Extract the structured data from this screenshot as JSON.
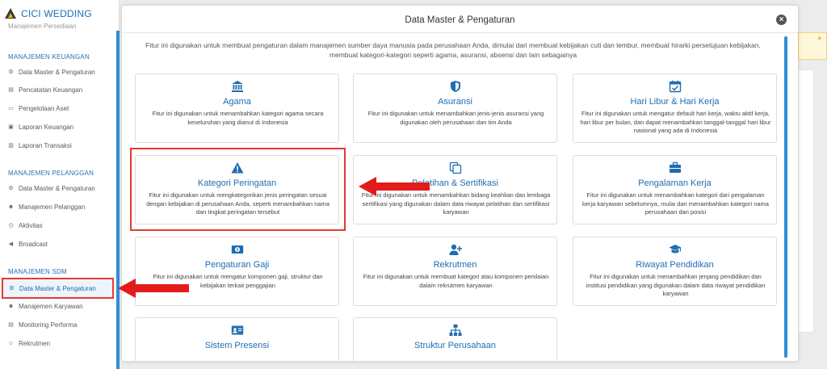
{
  "app": {
    "name": "CICI WEDDING"
  },
  "sidebar": {
    "cut_item": "Manajemen Persediaan",
    "sections": [
      {
        "title": "MANAJEMEN KEUANGAN",
        "items": [
          "Data Master & Pengaturan",
          "Pencatatan Keuangan",
          "Pengelolaan Aset",
          "Laporan Keuangan",
          "Laporan Transaksi"
        ]
      },
      {
        "title": "MANAJEMEN PELANGGAN",
        "items": [
          "Data Master & Pengaturan",
          "Manajemen Pelanggan",
          "Aktivitas",
          "Broadcast"
        ]
      },
      {
        "title": "MANAJEMEN SDM",
        "items": [
          "Data Master & Pengaturan",
          "Manajemen Karyawan",
          "Monitoring Performa",
          "Rekrutmen"
        ]
      }
    ],
    "active_item": "Data Master & Pengaturan"
  },
  "background": {
    "close_glyph": "×"
  },
  "modal": {
    "title": "Data Master & Pengaturan",
    "close_glyph": "×",
    "intro": "Fitur ini digunakan untuk membuat pengaturan dalam manajemen sumber daya manusia pada perusahaan Anda, dimulai dari membuat kebijakan cuti dan lembur, membuat hirarki persetujuan kebijakan, membuat kategori-kategori seperti agama, asuransi, absensi dan lain sebagainya",
    "cards": [
      {
        "title": "Agama",
        "icon": "bank-icon",
        "desc": "Fitur ini digunakan untuk menambahkan kategori agama secara keseluruhan yang dianut di Indonesia"
      },
      {
        "title": "Asuransi",
        "icon": "shield-icon",
        "desc": "Fitur ini digunakan untuk menambahkan jenis-jenis asuransi yang digunakan oleh perusahaan dan tim Anda"
      },
      {
        "title": "Hari Libur & Hari Kerja",
        "icon": "calendar-check-icon",
        "desc": "Fitur ini digunakan untuk mengatur default hari kerja, waktu aktif kerja, hari libur per bulan, dan dapat menambahkan tanggal-tanggal hari libur nasional yang ada di Indonesia"
      },
      {
        "title": "Kategori Peringatan",
        "icon": "warning-icon",
        "desc": "Fitur ini digunakan untuk mengkategorikan jenis peringatan sesuai dengan kebijakan di perusahaan Anda, seperti menambahkan nama dan tingkat peringatan tersebut"
      },
      {
        "title": "Pelatihan & Sertifikasi",
        "icon": "copy-icon",
        "desc": "Fitur ini digunakan untuk menambahkan bidang keahlian dan lembaga sertifikasi yang digunakan dalam data riwayat pelatihan dan sertifikasi karyawan"
      },
      {
        "title": "Pengalaman Kerja",
        "icon": "briefcase-icon",
        "desc": "Fitur ini digunakan untuk menambahkan kategori dari pengalaman kerja karyawan sebelumnya, mulai dari menambahkan kategori nama perusahaan dan posisi"
      },
      {
        "title": "Pengaturan Gaji",
        "icon": "money-icon",
        "desc": "Fitur ini digunakan untuk mengatur komponen gaji, struktur dan kebijakan terkait penggajian"
      },
      {
        "title": "Rekrutmen",
        "icon": "user-plus-icon",
        "desc": "Fitur ini digunakan untuk membuat kategori atau komponen penilaian dalam rekrutmen karyawan"
      },
      {
        "title": "Riwayat Pendidikan",
        "icon": "graduation-cap-icon",
        "desc": "Fitur ini digunakan untuk menambahkan jenjang pendidikan dan institusi pendidikan yang digunakan dalam data riwayat pendidikan karyawan"
      },
      {
        "title": "Sistem Presensi",
        "icon": "id-card-icon",
        "desc": ""
      },
      {
        "title": "Struktur Perusahaan",
        "icon": "sitemap-icon",
        "desc": ""
      }
    ]
  },
  "colors": {
    "accent": "#1f6db3",
    "highlight": "#e53935",
    "scroll": "#2f8fd6"
  }
}
